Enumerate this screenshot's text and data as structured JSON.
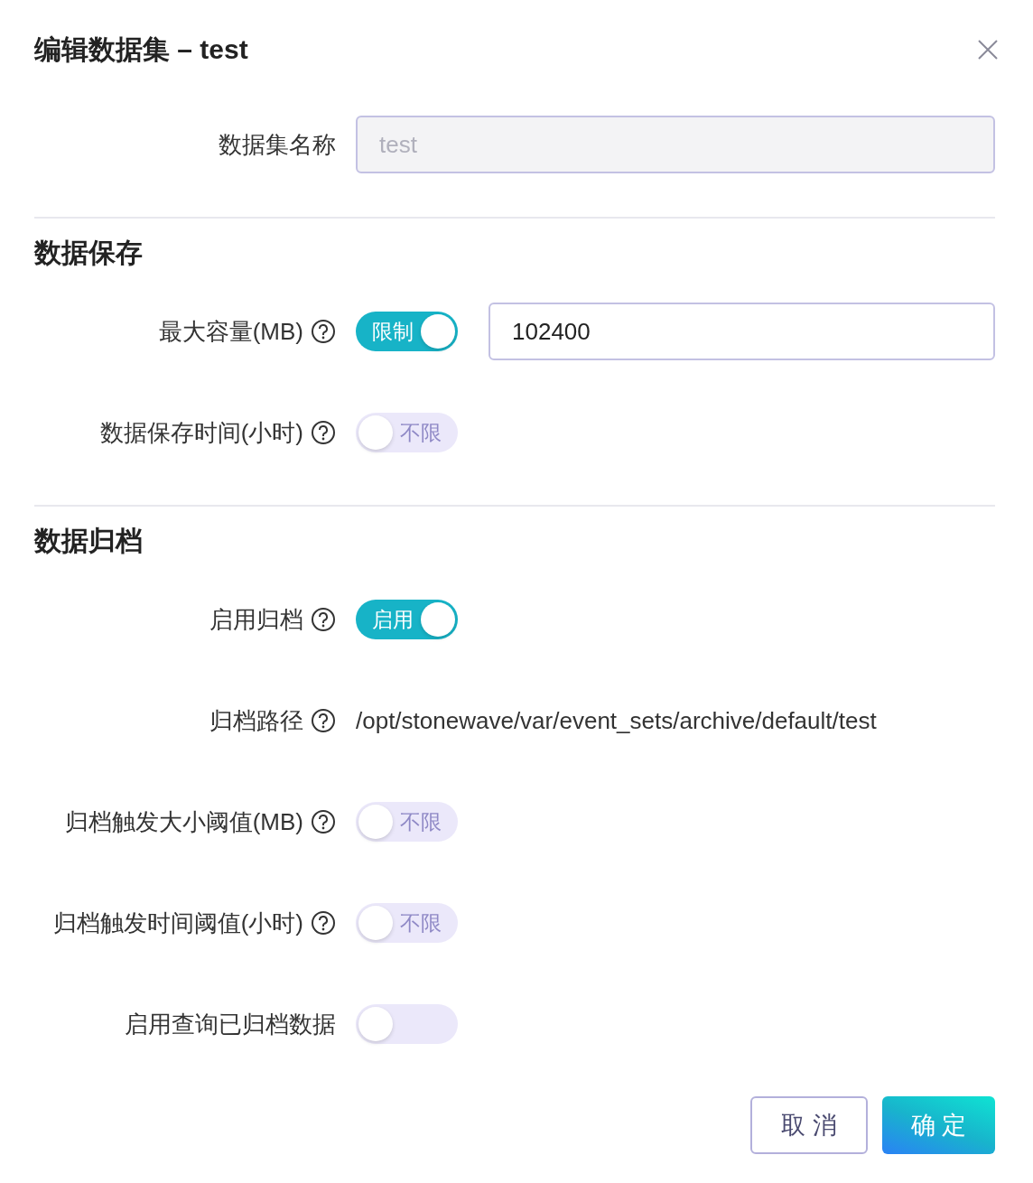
{
  "dialog": {
    "title": "编辑数据集 – test"
  },
  "sections": [
    {
      "rows": [
        {
          "kind": "input",
          "label": "数据集名称",
          "help": false,
          "value": "test",
          "disabled": true
        }
      ]
    },
    {
      "title": "数据保存",
      "rows": [
        {
          "kind": "switch",
          "label": "最大容量(MB)",
          "help": true,
          "on": true,
          "switch_text": "限制",
          "value": "102400"
        },
        {
          "kind": "switch",
          "label": "数据保存时间(小时)",
          "help": true,
          "on": false,
          "switch_text": "不限"
        }
      ]
    },
    {
      "title": "数据归档",
      "rows": [
        {
          "kind": "switch",
          "label": "启用归档",
          "help": true,
          "on": true,
          "switch_text": "启用"
        },
        {
          "kind": "text",
          "label": "归档路径",
          "help": true,
          "value": "/opt/stonewave/var/event_sets/archive/default/test"
        },
        {
          "kind": "switch",
          "label": "归档触发大小阈值(MB)",
          "help": true,
          "on": false,
          "switch_text": "不限"
        },
        {
          "kind": "switch",
          "label": "归档触发时间阈值(小时)",
          "help": true,
          "on": false,
          "switch_text": "不限"
        },
        {
          "kind": "switch",
          "label": "启用查询已归档数据",
          "help": false,
          "on": false
        }
      ]
    }
  ],
  "buttons": [
    {
      "label": "取 消",
      "kind": "secondary"
    },
    {
      "label": "确 定",
      "kind": "primary"
    }
  ]
}
